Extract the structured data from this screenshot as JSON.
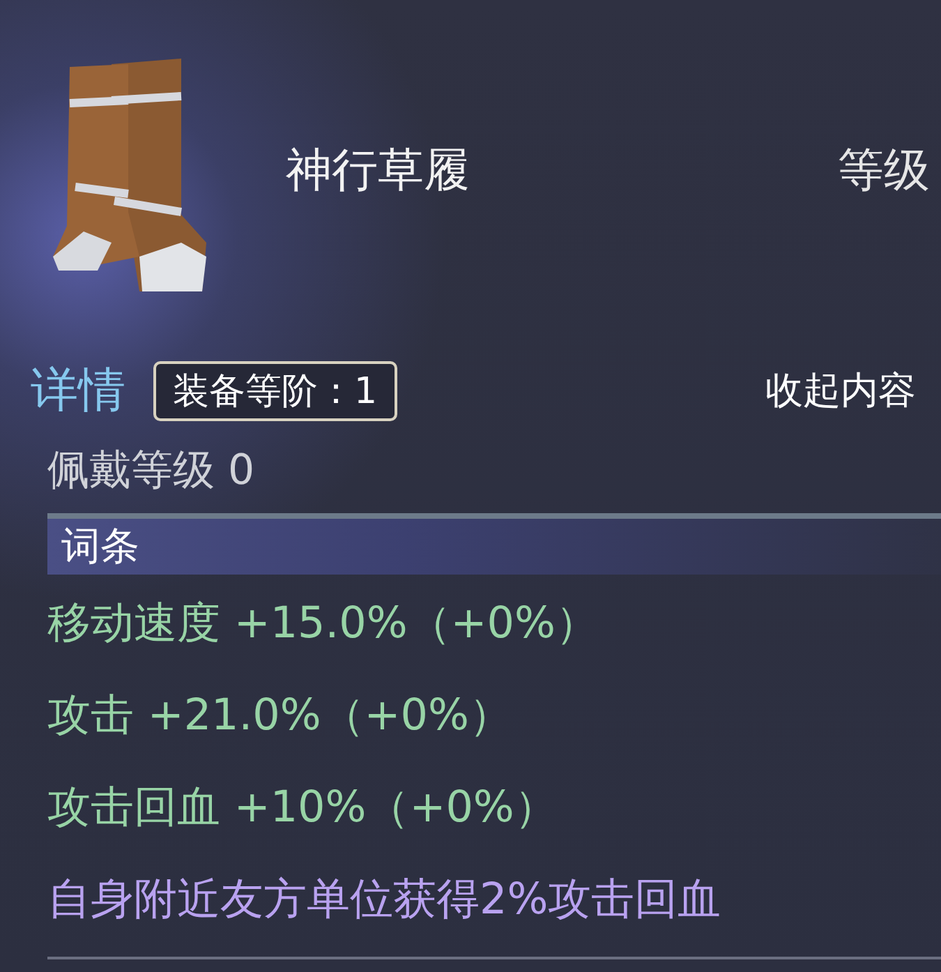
{
  "item": {
    "name": "神行草履",
    "level_label": "等级"
  },
  "details": {
    "tab_label": "详情",
    "tier_badge": "装备等阶：1",
    "collapse_label": "收起内容"
  },
  "requirement": "佩戴等级 0",
  "affix_section": {
    "title": "词条"
  },
  "affixes": [
    {
      "kind": "stat",
      "text": "移动速度 +15.0%（+0%）"
    },
    {
      "kind": "stat",
      "text": "攻击 +21.0%（+0%）"
    },
    {
      "kind": "stat",
      "text": "攻击回血 +10%（+0%）"
    },
    {
      "kind": "effect",
      "text": "自身附近友方单位获得2%攻击回血"
    }
  ]
}
